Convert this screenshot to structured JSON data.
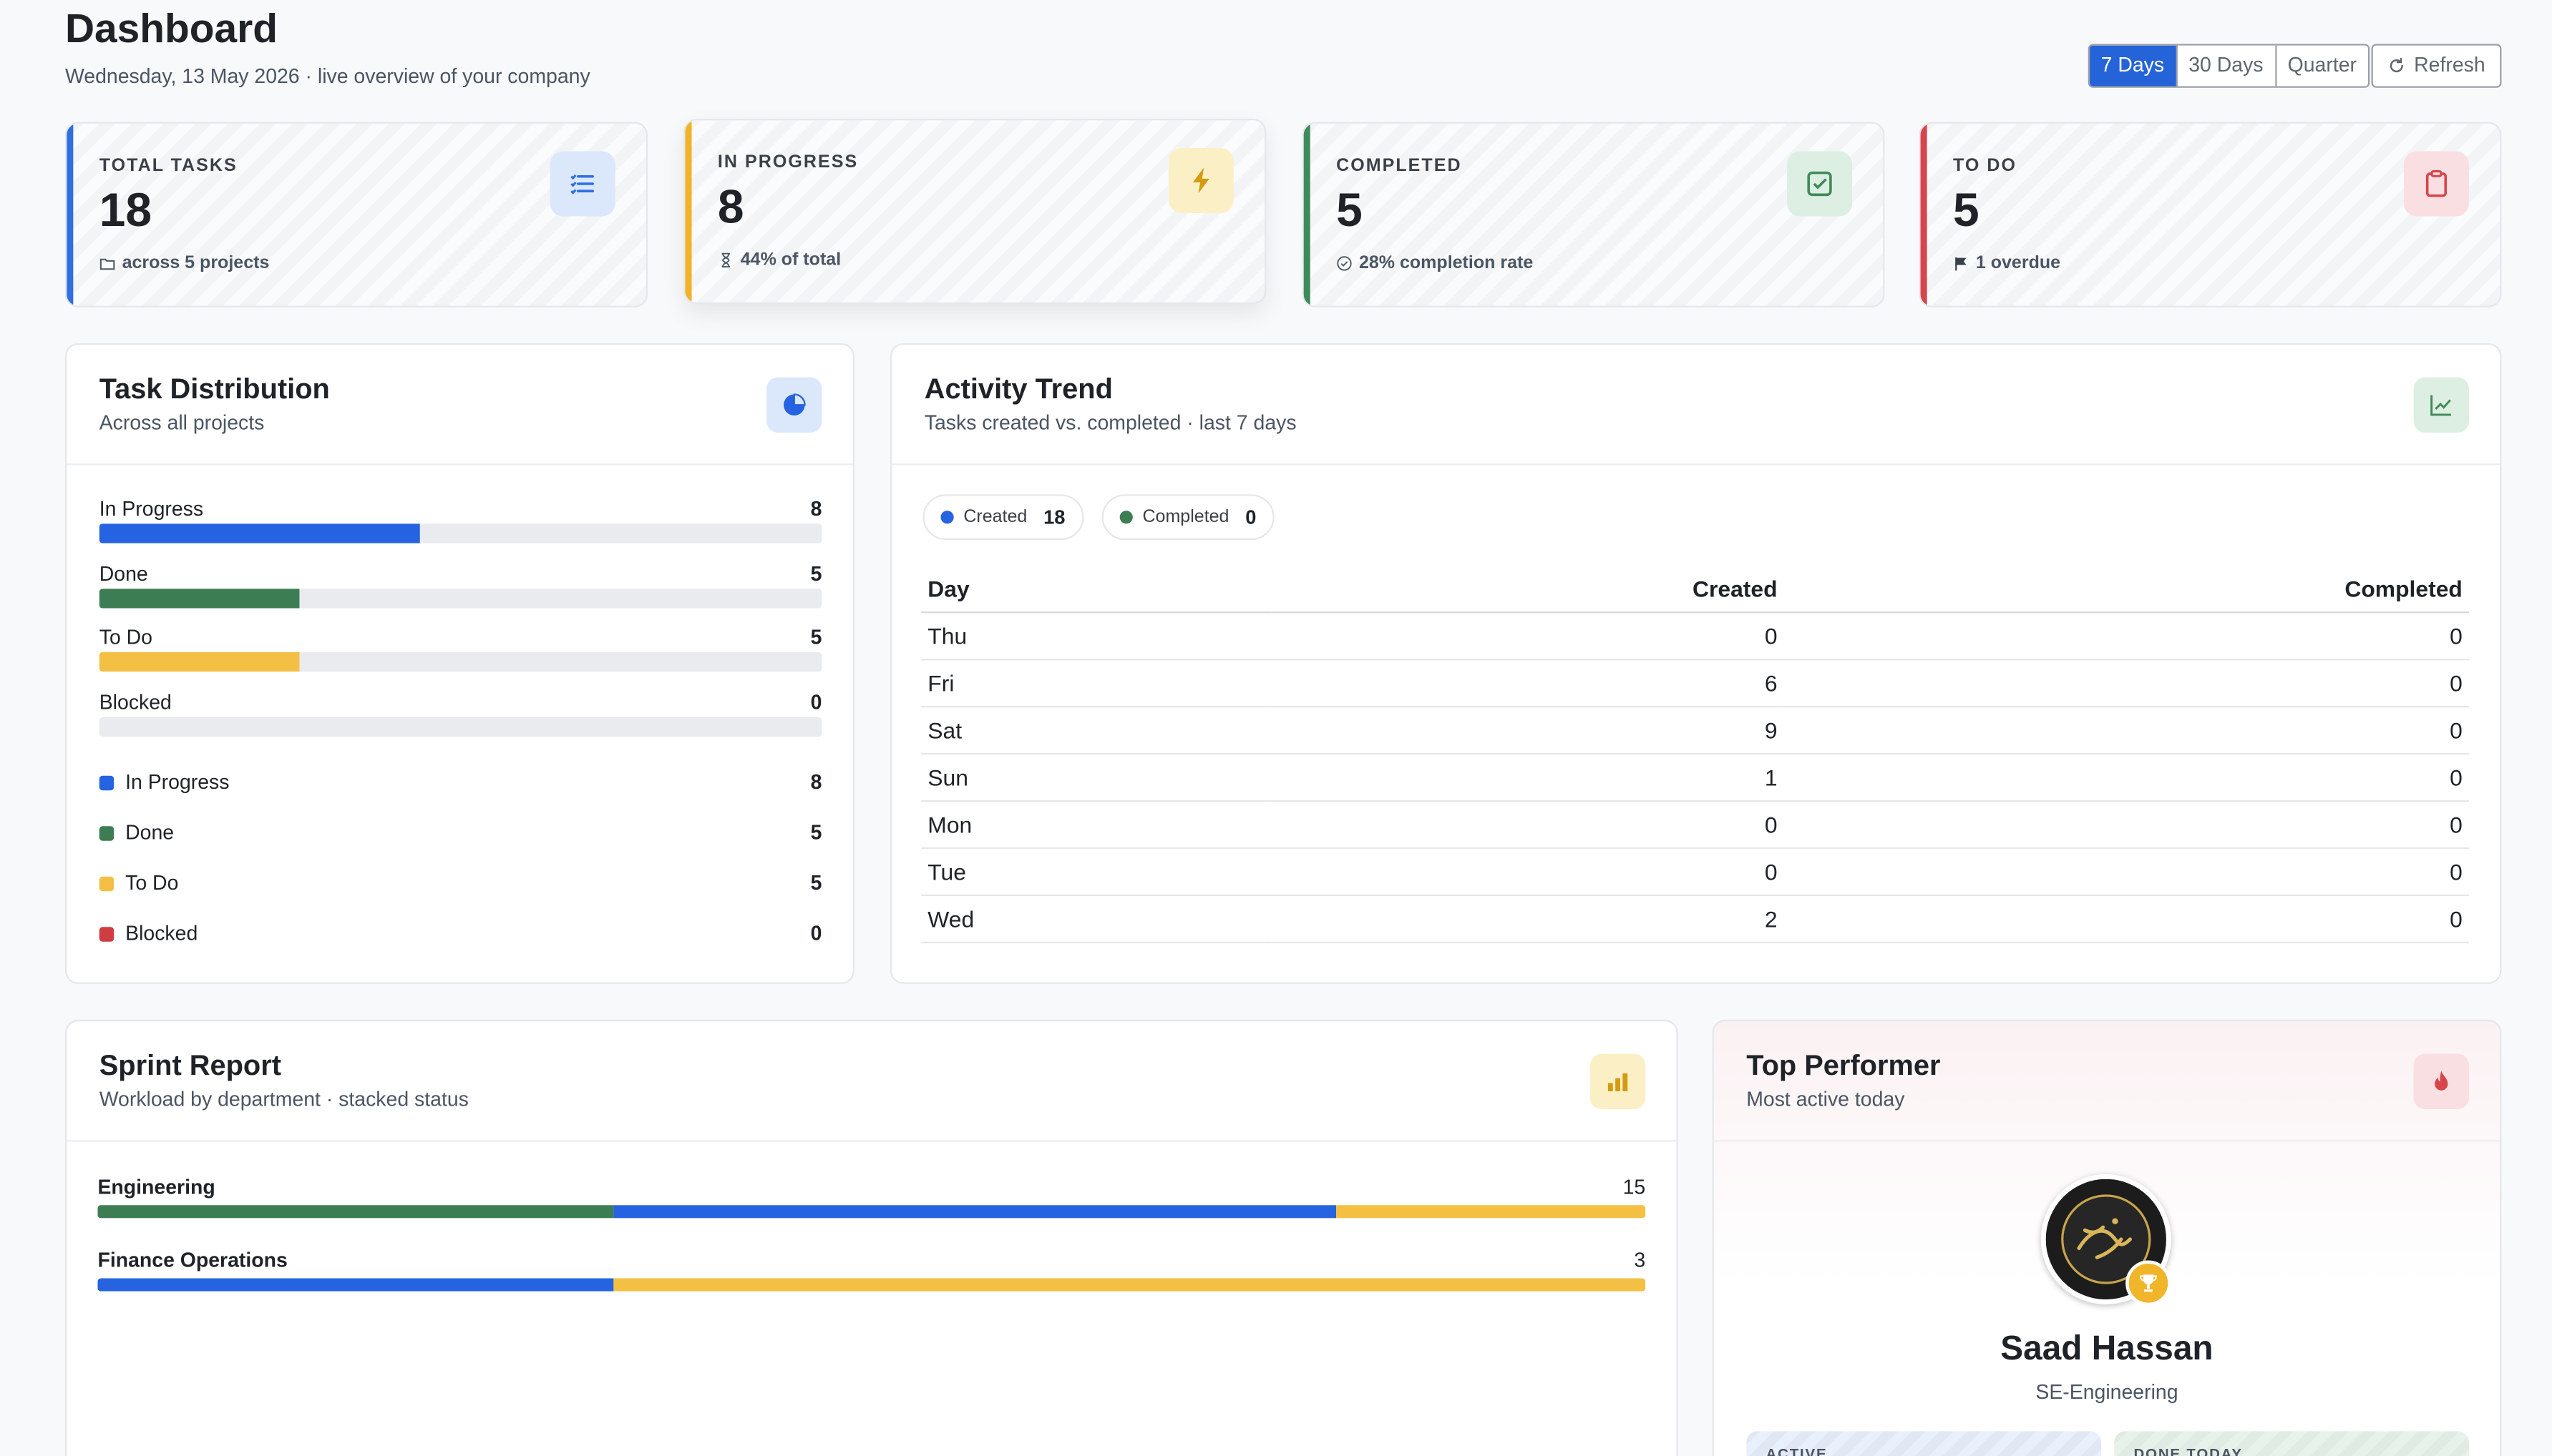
{
  "header": {
    "title": "Dashboard",
    "subtitle": "Wednesday, 13 May 2026 · live overview of your company",
    "ranges": [
      "7 Days",
      "30 Days",
      "Quarter"
    ],
    "active_range": "7 Days",
    "refresh_label": "Refresh"
  },
  "stats": {
    "total": {
      "label": "TOTAL TASKS",
      "value": "18",
      "note": "across 5 projects",
      "color": "#2f6fdf"
    },
    "in_progress": {
      "label": "IN PROGRESS",
      "value": "8",
      "note": "44% of total",
      "color": "#f0b429"
    },
    "completed": {
      "label": "COMPLETED",
      "value": "5",
      "note": "28% completion rate",
      "color": "#3f8a5a"
    },
    "todo": {
      "label": "TO DO",
      "value": "5",
      "note": "1 overdue",
      "color": "#d6454b"
    }
  },
  "distribution": {
    "title": "Task Distribution",
    "subtitle": "Across all projects",
    "items": [
      {
        "label": "In Progress",
        "count": "8",
        "value": 8,
        "color": "#2563e0"
      },
      {
        "label": "Done",
        "count": "5",
        "value": 5,
        "color": "#3d7d54"
      },
      {
        "label": "To Do",
        "count": "5",
        "value": 5,
        "color": "#f4c043"
      },
      {
        "label": "Blocked",
        "count": "0",
        "value": 0,
        "color": "#cf3d43"
      }
    ],
    "max": 18
  },
  "activity": {
    "title": "Activity Trend",
    "subtitle": "Tasks created vs. completed · last 7 days",
    "created_label": "Created",
    "created_total": "18",
    "completed_label": "Completed",
    "completed_total": "0",
    "columns": [
      "Day",
      "Created",
      "Completed"
    ],
    "rows": [
      {
        "day": "Thu",
        "created": "0",
        "completed": "0"
      },
      {
        "day": "Fri",
        "created": "6",
        "completed": "0"
      },
      {
        "day": "Sat",
        "created": "9",
        "completed": "0"
      },
      {
        "day": "Sun",
        "created": "1",
        "completed": "0"
      },
      {
        "day": "Mon",
        "created": "0",
        "completed": "0"
      },
      {
        "day": "Tue",
        "created": "0",
        "completed": "0"
      },
      {
        "day": "Wed",
        "created": "2",
        "completed": "0"
      }
    ]
  },
  "sprint": {
    "title": "Sprint Report",
    "subtitle": "Workload by department · stacked status",
    "departments": [
      {
        "name": "Engineering",
        "count": "15",
        "segments": [
          {
            "status": "Done",
            "fraction": 0.333,
            "color": "#3d7d54"
          },
          {
            "status": "In Progress",
            "fraction": 0.467,
            "color": "#2563e0"
          },
          {
            "status": "To Do",
            "fraction": 0.2,
            "color": "#f4c043"
          }
        ]
      },
      {
        "name": "Finance Operations",
        "count": "3",
        "segments": [
          {
            "status": "In Progress",
            "fraction": 0.333,
            "color": "#2563e0"
          },
          {
            "status": "To Do",
            "fraction": 0.667,
            "color": "#f4c043"
          }
        ]
      }
    ]
  },
  "performer": {
    "title": "Top Performer",
    "subtitle": "Most active today",
    "name": "Saad Hassan",
    "role": "SE-Engineering",
    "mini_cards": [
      {
        "label": "ACTIVE",
        "color": "#e8f0fb"
      },
      {
        "label": "DONE TODAY",
        "color": "#e7f3ea"
      }
    ]
  }
}
